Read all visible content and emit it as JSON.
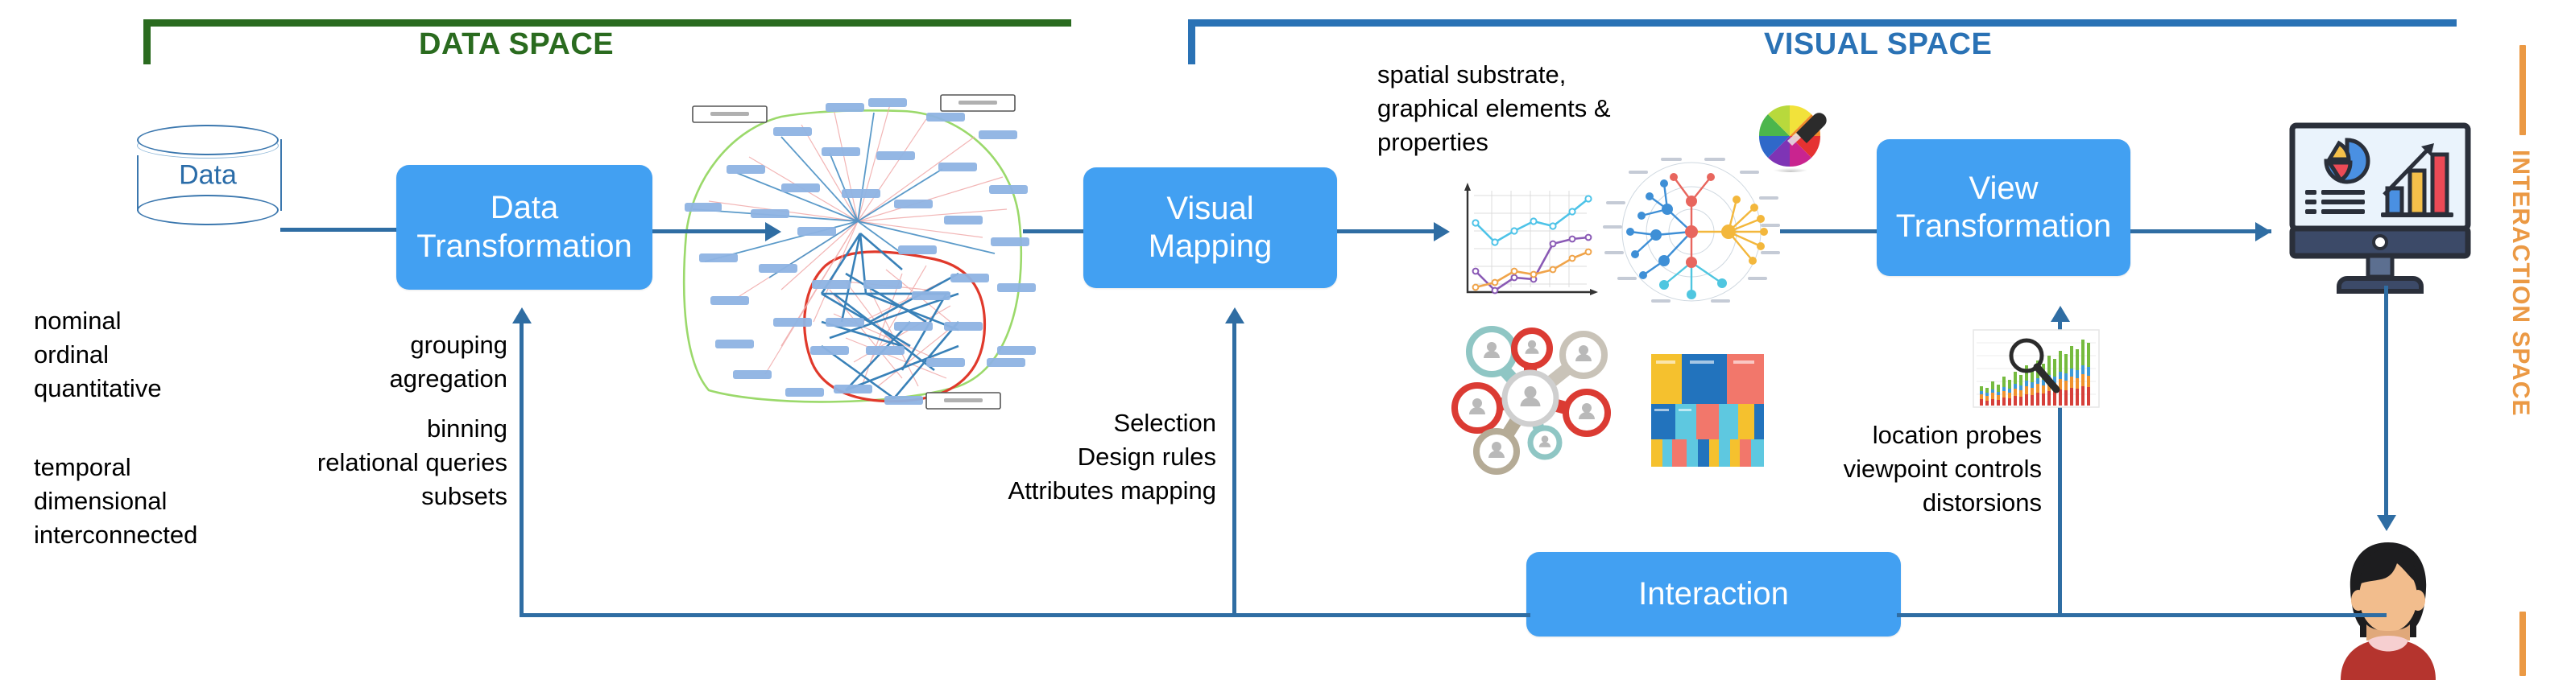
{
  "spaces": {
    "data_space": {
      "title": "DATA SPACE",
      "color": "#2a6b1f"
    },
    "visual_space": {
      "title": "VISUAL SPACE",
      "color": "#2a72b5"
    },
    "interaction_space": {
      "title": "INTERACTION SPACE",
      "color": "#eb9944"
    }
  },
  "nodes": {
    "data_store": {
      "label": "Data"
    },
    "data_transformation": {
      "label": "Data\nTransformation"
    },
    "visual_mapping": {
      "label": "Visual\nMapping"
    },
    "view_transformation": {
      "label": "View\nTransformation"
    },
    "interaction": {
      "label": "Interaction"
    }
  },
  "annotations": {
    "data_types_primary": "nominal\nordinal\nquantitative",
    "data_types_secondary": "temporal\ndimensional\ninterconnected",
    "data_transform_ops_primary": "grouping\nagregation",
    "data_transform_ops_secondary": "binning\nrelational queries\nsubsets",
    "visual_mapping_inputs": "Selection\nDesign rules\nAttributes mapping",
    "visual_structures": "spatial substrate,\ngraphical elements &\nproperties",
    "view_transform_ops": "location probes\nviewpoint controls\ndistorsions"
  },
  "icons": {
    "network_graph": "network-graph-visualization",
    "line_chart": "line-chart-icon",
    "radial_network": "radial-network-chart-icon",
    "color_wheel": "color-picker-wheel-icon",
    "social_network": "social-network-people-icon",
    "treemap": "treemap-chart-icon",
    "magnified_bars": "magnifier-over-bar-chart-icon",
    "monitor_dashboard": "monitor-dashboard-icon",
    "user_avatar": "user-avatar-icon"
  },
  "colors": {
    "process_box": "#42a0f2",
    "connector": "#2f6da3",
    "data_space": "#2a6b1f",
    "visual_space": "#2a72b5",
    "interaction_space": "#eb9944",
    "cylinder_stroke": "#3b77ae"
  }
}
